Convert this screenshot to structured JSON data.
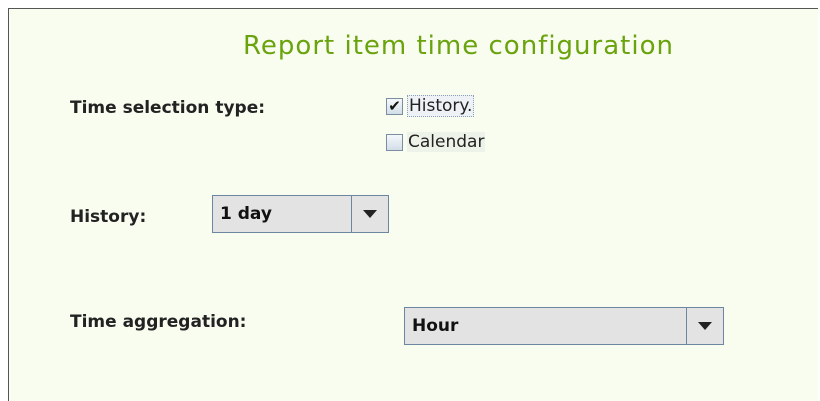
{
  "title": "Report item time configuration",
  "time_selection": {
    "label": "Time selection type:",
    "options": [
      {
        "label": "History.",
        "checked": true,
        "check_glyph": "✔"
      },
      {
        "label": "Calendar",
        "checked": false,
        "check_glyph": ""
      }
    ]
  },
  "history": {
    "label": "History:",
    "value": "1 day"
  },
  "aggregation": {
    "label": "Time aggregation:",
    "value": "Hour"
  },
  "colors": {
    "title": "#6aa30d",
    "panel_bg": "#f8fdf0"
  }
}
